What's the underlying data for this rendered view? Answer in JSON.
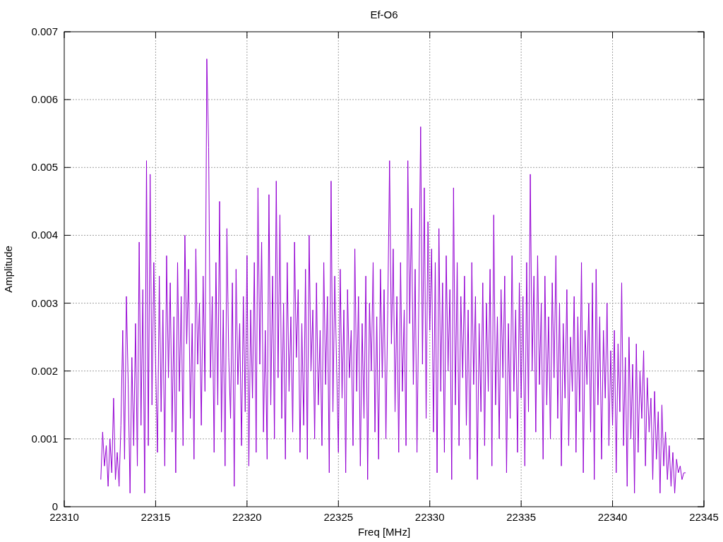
{
  "chart_data": {
    "type": "line",
    "title": "Ef-O6",
    "xlabel": "Freq [MHz]",
    "ylabel": "Amplitude",
    "xlim": [
      22310,
      22345
    ],
    "ylim": [
      0,
      0.007
    ],
    "grid": true,
    "xticks": [
      {
        "value": 22310,
        "label": "22310"
      },
      {
        "value": 22315,
        "label": "22315"
      },
      {
        "value": 22320,
        "label": "22320"
      },
      {
        "value": 22325,
        "label": "22325"
      },
      {
        "value": 22330,
        "label": "22330"
      },
      {
        "value": 22335,
        "label": "22335"
      },
      {
        "value": 22340,
        "label": "22340"
      },
      {
        "value": 22345,
        "label": "22345"
      }
    ],
    "yticks": [
      {
        "value": 0,
        "label": "0"
      },
      {
        "value": 0.001,
        "label": "0.001"
      },
      {
        "value": 0.002,
        "label": "0.002"
      },
      {
        "value": 0.003,
        "label": "0.003"
      },
      {
        "value": 0.004,
        "label": "0.004"
      },
      {
        "value": 0.005,
        "label": "0.005"
      },
      {
        "value": 0.006,
        "label": "0.006"
      },
      {
        "value": 0.007,
        "label": "0.007"
      }
    ],
    "x": [
      22312,
      22312.1,
      22312.2,
      22312.3,
      22312.4,
      22312.5,
      22312.6,
      22312.7,
      22312.8,
      22312.9,
      22313,
      22313.1,
      22313.2,
      22313.3,
      22313.4,
      22313.5,
      22313.6,
      22313.7,
      22313.8,
      22313.9,
      22314,
      22314.1,
      22314.2,
      22314.3,
      22314.4,
      22314.5,
      22314.6,
      22314.7,
      22314.8,
      22314.9,
      22315,
      22315.1,
      22315.2,
      22315.3,
      22315.4,
      22315.5,
      22315.6,
      22315.7,
      22315.8,
      22315.9,
      22316,
      22316.1,
      22316.2,
      22316.3,
      22316.4,
      22316.5,
      22316.6,
      22316.7,
      22316.8,
      22316.9,
      22317,
      22317.1,
      22317.2,
      22317.3,
      22317.4,
      22317.5,
      22317.6,
      22317.7,
      22317.8,
      22317.9,
      22318,
      22318.1,
      22318.2,
      22318.3,
      22318.4,
      22318.5,
      22318.6,
      22318.7,
      22318.8,
      22318.9,
      22319,
      22319.1,
      22319.2,
      22319.3,
      22319.4,
      22319.5,
      22319.6,
      22319.7,
      22319.8,
      22319.9,
      22320,
      22320.1,
      22320.2,
      22320.3,
      22320.4,
      22320.5,
      22320.6,
      22320.7,
      22320.8,
      22320.9,
      22321,
      22321.1,
      22321.2,
      22321.3,
      22321.4,
      22321.5,
      22321.6,
      22321.7,
      22321.8,
      22321.9,
      22322,
      22322.1,
      22322.2,
      22322.3,
      22322.4,
      22322.5,
      22322.6,
      22322.7,
      22322.8,
      22322.9,
      22323,
      22323.1,
      22323.2,
      22323.3,
      22323.4,
      22323.5,
      22323.6,
      22323.7,
      22323.8,
      22323.9,
      22324,
      22324.1,
      22324.2,
      22324.3,
      22324.4,
      22324.5,
      22324.6,
      22324.7,
      22324.8,
      22324.9,
      22325,
      22325.1,
      22325.2,
      22325.3,
      22325.4,
      22325.5,
      22325.6,
      22325.7,
      22325.8,
      22325.9,
      22326,
      22326.1,
      22326.2,
      22326.3,
      22326.4,
      22326.5,
      22326.6,
      22326.7,
      22326.8,
      22326.9,
      22327,
      22327.1,
      22327.2,
      22327.3,
      22327.4,
      22327.5,
      22327.6,
      22327.7,
      22327.8,
      22327.9,
      22328,
      22328.1,
      22328.2,
      22328.3,
      22328.4,
      22328.5,
      22328.6,
      22328.7,
      22328.8,
      22328.9,
      22329,
      22329.1,
      22329.2,
      22329.3,
      22329.4,
      22329.5,
      22329.6,
      22329.7,
      22329.8,
      22329.9,
      22330,
      22330.1,
      22330.2,
      22330.3,
      22330.4,
      22330.5,
      22330.6,
      22330.7,
      22330.8,
      22330.9,
      22331,
      22331.1,
      22331.2,
      22331.3,
      22331.4,
      22331.5,
      22331.6,
      22331.7,
      22331.8,
      22331.9,
      22332,
      22332.1,
      22332.2,
      22332.3,
      22332.4,
      22332.5,
      22332.6,
      22332.7,
      22332.8,
      22332.9,
      22333,
      22333.1,
      22333.2,
      22333.3,
      22333.4,
      22333.5,
      22333.6,
      22333.7,
      22333.8,
      22333.9,
      22334,
      22334.1,
      22334.2,
      22334.3,
      22334.4,
      22334.5,
      22334.6,
      22334.7,
      22334.8,
      22334.9,
      22335,
      22335.1,
      22335.2,
      22335.3,
      22335.4,
      22335.5,
      22335.6,
      22335.7,
      22335.8,
      22335.9,
      22336,
      22336.1,
      22336.2,
      22336.3,
      22336.4,
      22336.5,
      22336.6,
      22336.7,
      22336.8,
      22336.9,
      22337,
      22337.1,
      22337.2,
      22337.3,
      22337.4,
      22337.5,
      22337.6,
      22337.7,
      22337.8,
      22337.9,
      22338,
      22338.1,
      22338.2,
      22338.3,
      22338.4,
      22338.5,
      22338.6,
      22338.7,
      22338.8,
      22338.9,
      22339,
      22339.1,
      22339.2,
      22339.3,
      22339.4,
      22339.5,
      22339.6,
      22339.7,
      22339.8,
      22339.9,
      22340,
      22340.1,
      22340.2,
      22340.3,
      22340.4,
      22340.5,
      22340.6,
      22340.7,
      22340.8,
      22340.9,
      22341,
      22341.1,
      22341.2,
      22341.3,
      22341.4,
      22341.5,
      22341.6,
      22341.7,
      22341.8,
      22341.9,
      22342,
      22342.1,
      22342.2,
      22342.3,
      22342.4,
      22342.5,
      22342.6,
      22342.7,
      22342.8,
      22342.9,
      22343,
      22343.1,
      22343.2,
      22343.3,
      22343.4,
      22343.5,
      22343.6,
      22343.7,
      22343.8,
      22343.9,
      22344
    ],
    "series": [
      {
        "color": "#9400d3",
        "values": [
          0.0004,
          0.0011,
          0.0006,
          0.0009,
          0.0003,
          0.001,
          0.0005,
          0.0016,
          0.0004,
          0.0008,
          0.0003,
          0.0012,
          0.0026,
          0.0007,
          0.0031,
          0.0018,
          0.0002,
          0.0022,
          0.0009,
          0.0027,
          0.0006,
          0.0039,
          0.0012,
          0.0032,
          0.0002,
          0.0051,
          0.0009,
          0.0049,
          0.0015,
          0.0036,
          0.0021,
          0.0008,
          0.0034,
          0.0014,
          0.0029,
          0.0006,
          0.0037,
          0.0019,
          0.0033,
          0.0011,
          0.0028,
          0.0005,
          0.0036,
          0.0017,
          0.0031,
          0.0009,
          0.004,
          0.0024,
          0.0035,
          0.0013,
          0.0027,
          0.0007,
          0.0038,
          0.0021,
          0.003,
          0.0012,
          0.0034,
          0.0017,
          0.0066,
          0.0053,
          0.0019,
          0.0031,
          0.0008,
          0.0036,
          0.0015,
          0.0045,
          0.0011,
          0.0029,
          0.0006,
          0.0041,
          0.0022,
          0.0013,
          0.0033,
          0.0003,
          0.0035,
          0.0018,
          0.0027,
          0.0009,
          0.0031,
          0.0014,
          0.0037,
          0.0006,
          0.0029,
          0.0016,
          0.0036,
          0.0008,
          0.0047,
          0.0021,
          0.0039,
          0.0011,
          0.0026,
          0.0007,
          0.0046,
          0.0015,
          0.0034,
          0.001,
          0.0048,
          0.0019,
          0.0043,
          0.0013,
          0.003,
          0.0007,
          0.0036,
          0.0017,
          0.0028,
          0.0011,
          0.0039,
          0.0022,
          0.0032,
          0.0008,
          0.0027,
          0.0012,
          0.0035,
          0.0007,
          0.004,
          0.002,
          0.0029,
          0.001,
          0.0033,
          0.0015,
          0.0026,
          0.0009,
          0.0036,
          0.0018,
          0.0031,
          0.0005,
          0.0048,
          0.0014,
          0.0034,
          0.0021,
          0.0008,
          0.0035,
          0.0016,
          0.0029,
          0.0005,
          0.0032,
          0.0019,
          0.0026,
          0.0009,
          0.0038,
          0.0017,
          0.0031,
          0.0006,
          0.0027,
          0.0013,
          0.0034,
          0.0004,
          0.003,
          0.002,
          0.0036,
          0.0011,
          0.0028,
          0.0007,
          0.0035,
          0.0019,
          0.0032,
          0.001,
          0.0029,
          0.0051,
          0.0024,
          0.0038,
          0.0014,
          0.0031,
          0.0008,
          0.0036,
          0.0017,
          0.0029,
          0.0009,
          0.0051,
          0.0027,
          0.0044,
          0.0018,
          0.0035,
          0.0008,
          0.003,
          0.0056,
          0.0021,
          0.0047,
          0.0013,
          0.0042,
          0.0026,
          0.0038,
          0.0011,
          0.0036,
          0.0005,
          0.0041,
          0.0017,
          0.0033,
          0.0008,
          0.0037,
          0.002,
          0.0032,
          0.0004,
          0.0047,
          0.0015,
          0.0036,
          0.0009,
          0.0031,
          0.0019,
          0.0034,
          0.0012,
          0.0029,
          0.0007,
          0.0036,
          0.0018,
          0.0031,
          0.0004,
          0.0027,
          0.0014,
          0.0033,
          0.0009,
          0.003,
          0.0017,
          0.0035,
          0.0006,
          0.0043,
          0.0015,
          0.0028,
          0.001,
          0.0032,
          0.0019,
          0.0034,
          0.0005,
          0.0027,
          0.0013,
          0.0037,
          0.0017,
          0.0029,
          0.0008,
          0.0033,
          0.0016,
          0.0031,
          0.0006,
          0.0036,
          0.0014,
          0.0049,
          0.002,
          0.0034,
          0.0011,
          0.0037,
          0.0018,
          0.003,
          0.0007,
          0.0034,
          0.0015,
          0.0028,
          0.001,
          0.0033,
          0.0019,
          0.0037,
          0.0013,
          0.003,
          0.0006,
          0.0027,
          0.0016,
          0.0032,
          0.0009,
          0.0025,
          0.0017,
          0.0031,
          0.0008,
          0.0028,
          0.0014,
          0.0036,
          0.0005,
          0.0026,
          0.0018,
          0.003,
          0.0011,
          0.0033,
          0.0004,
          0.0035,
          0.0015,
          0.0028,
          0.0007,
          0.0026,
          0.0016,
          0.003,
          0.0009,
          0.0023,
          0.0012,
          0.0026,
          0.0005,
          0.0024,
          0.0014,
          0.0033,
          0.0009,
          0.0022,
          0.0003,
          0.0025,
          0.001,
          0.0021,
          0.0002,
          0.0024,
          0.0008,
          0.002,
          0.0013,
          0.0023,
          0.0006,
          0.0019,
          0.0011,
          0.0016,
          0.0004,
          0.0017,
          0.0007,
          0.0014,
          0.0002,
          0.0015,
          0.0006,
          0.0011,
          0.0004,
          0.0009,
          0.0003,
          0.0008,
          0.0002,
          0.0007,
          0.0005,
          0.0006,
          0.0004,
          0.0005,
          0.0005
        ]
      }
    ]
  }
}
